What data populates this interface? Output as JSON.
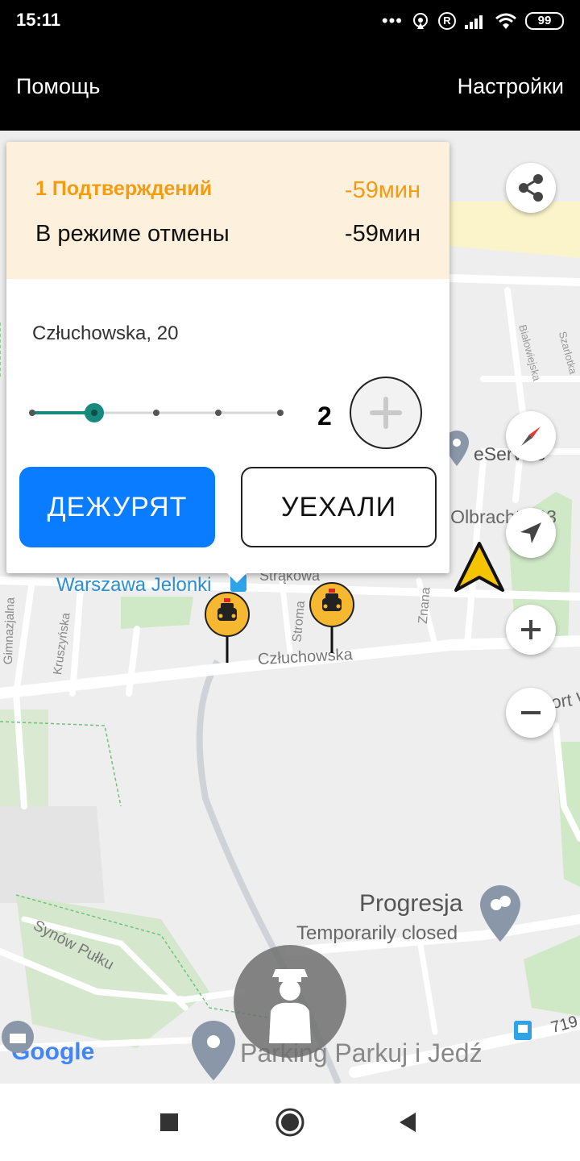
{
  "status_bar": {
    "time": "15:11",
    "dots": "•••",
    "registered_glyph": "R",
    "battery": "99",
    "icons": [
      "more-dots-icon",
      "hotspot-icon",
      "registered-icon",
      "signal-icon",
      "wifi-icon",
      "battery-icon"
    ]
  },
  "toolbar": {
    "help_label": "Помощь",
    "settings_label": "Настройки"
  },
  "card": {
    "confirmations_label": "1 Подтверждений",
    "confirmations_time": "-59мин",
    "cancel_mode_label": "В режиме отмены",
    "cancel_mode_time": "-59мин",
    "address": "Człuchowska, 20",
    "slider": {
      "value": 2,
      "min": 1,
      "max": 5,
      "steps": 5
    },
    "count": "2",
    "duty_button": "ДЕЖУРЯТ",
    "left_button": "УЕХАЛИ"
  },
  "map": {
    "labels": {
      "station": "Warszawa Jelonki",
      "strakowa": "Strąkowa",
      "czluchowska": "Człuchowska",
      "stroma": "Stroma",
      "znana": "Znana",
      "gimnazjalna": "Gimnazjalna",
      "kruszynska": "Kruszyńska",
      "bialowieska": "Białowiejska",
      "szarlotka": "Szarlotka",
      "eservice": "eService",
      "olbrachta": "a Olbrachta 23",
      "sport": "port W",
      "progresja": "Progresja",
      "temporarily_closed": "Temporarily closed",
      "synow_pulku": "Synów Pułku",
      "parking": "Parking Parkuj i Jedź",
      "route": "719",
      "google": "Google"
    },
    "colors": {
      "land": "#eeeeee",
      "road": "#ffffff",
      "park": "#cfe8c6",
      "highlight": "#fbf3c9",
      "taxi": "#f6b830",
      "my_location": "#f5c400",
      "poi": "#8a97a8"
    }
  },
  "fabs": [
    "share-icon",
    "compass-icon",
    "navigation-arrow-icon",
    "zoom-in-icon",
    "zoom-out-icon"
  ],
  "driver_button_icon": "driver-avatar-icon",
  "navbar": [
    "recent-apps-icon",
    "home-icon",
    "back-icon"
  ]
}
